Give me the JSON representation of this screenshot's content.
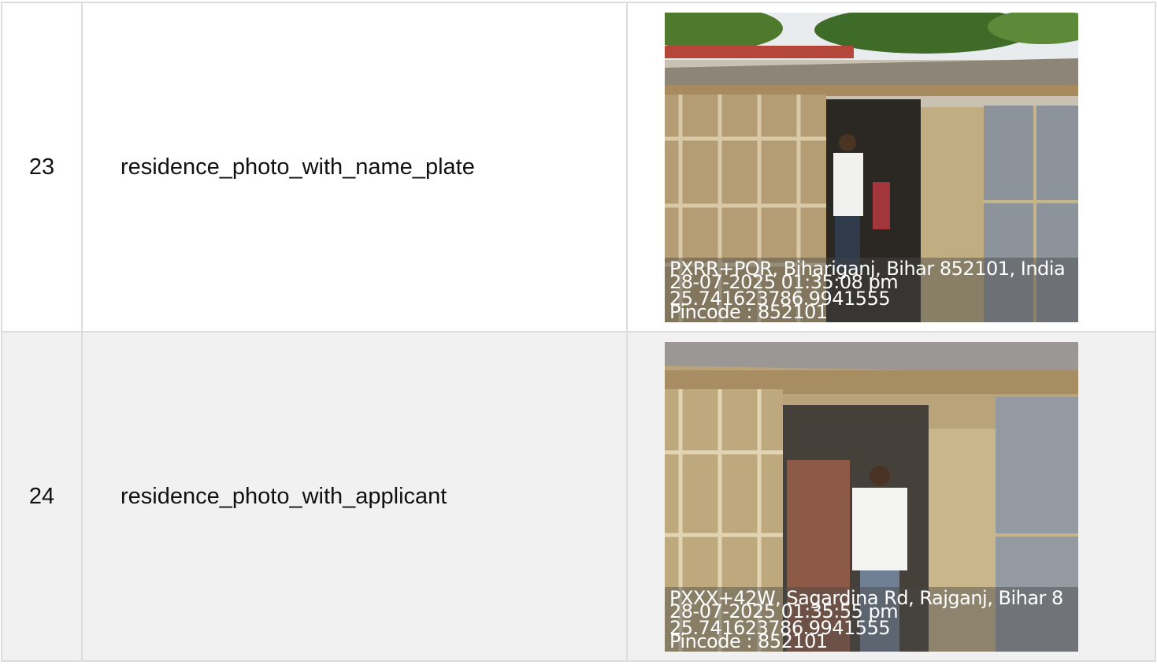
{
  "rows": [
    {
      "number": "23",
      "field": "residence_photo_with_name_plate",
      "photo": {
        "address": "PXRR+PQR, Bihariganj, Bihar 852101, India",
        "datetime": "28-07-2025 01:35:08 pm",
        "coords": "25.741623786.9941555",
        "pincode": "Pincode : 852101"
      }
    },
    {
      "number": "24",
      "field": "residence_photo_with_applicant",
      "photo": {
        "address": "PXXX+42W, Sagardina Rd, Rajganj, Bihar 8",
        "datetime": "28-07-2025 01:35:55 pm",
        "coords": "25.741623786.9941555",
        "pincode": "Pincode : 852101"
      }
    }
  ]
}
